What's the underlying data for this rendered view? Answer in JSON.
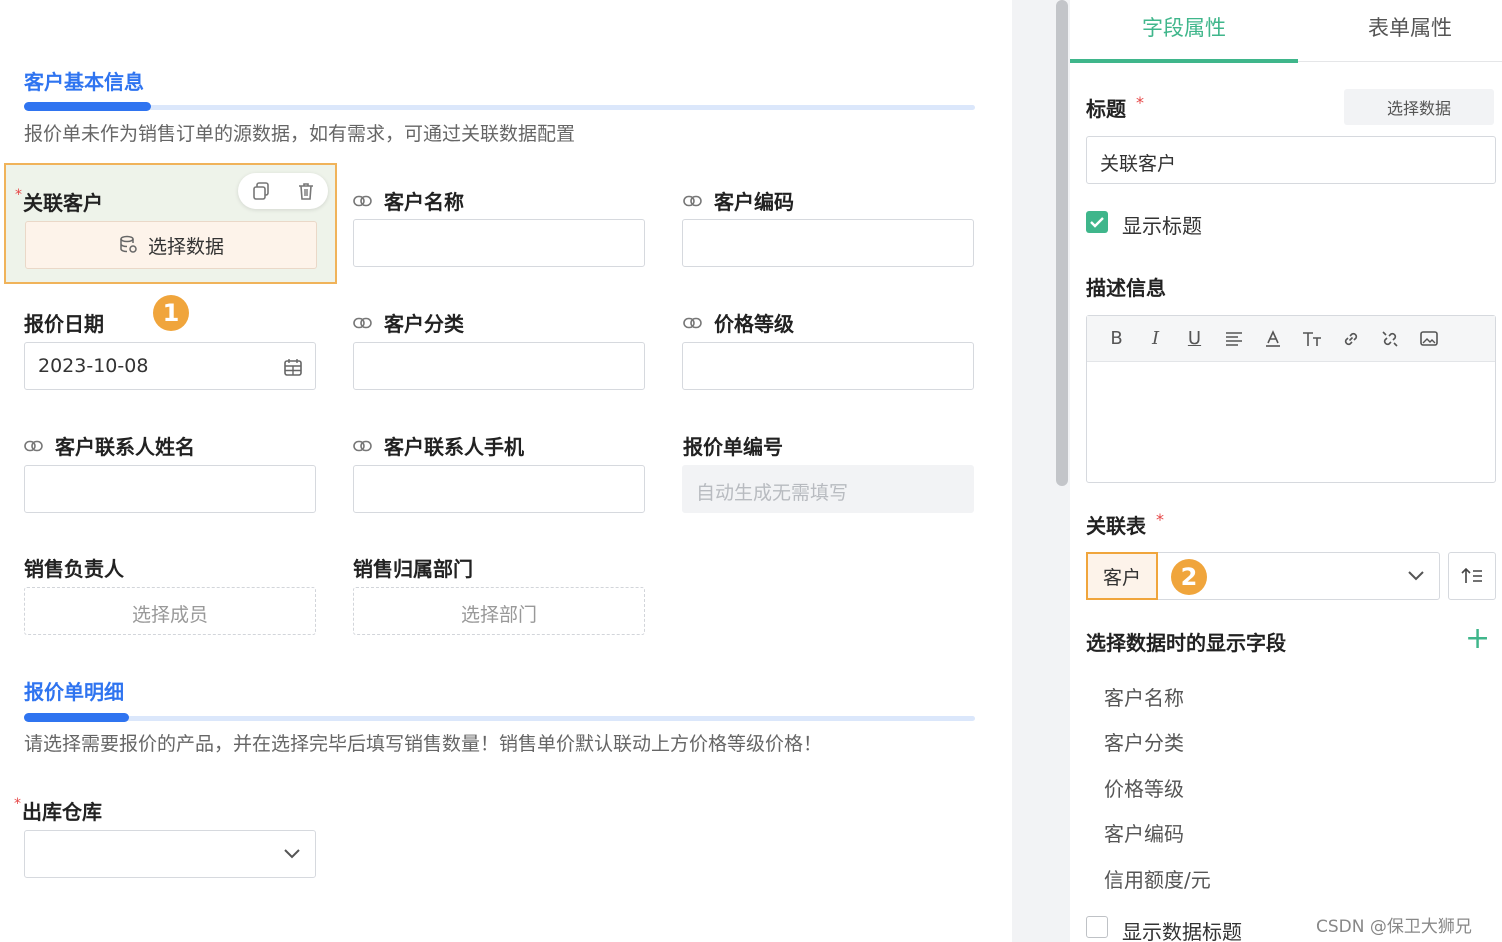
{
  "form": {
    "section1": {
      "title": "客户基本信息",
      "desc": "报价单未作为销售订单的源数据，如有需求，可通过关联数据配置"
    },
    "fields": {
      "related_customer": {
        "label": "关联客户",
        "button": "选择数据"
      },
      "customer_name": {
        "label": "客户名称"
      },
      "customer_code": {
        "label": "客户编码"
      },
      "quote_date": {
        "label": "报价日期",
        "value": "2023-10-08"
      },
      "customer_category": {
        "label": "客户分类"
      },
      "price_level": {
        "label": "价格等级"
      },
      "contact_name": {
        "label": "客户联系人姓名"
      },
      "contact_phone": {
        "label": "客户联系人手机"
      },
      "quote_number": {
        "label": "报价单编号",
        "placeholder": "自动生成无需填写"
      },
      "sales_owner": {
        "label": "销售负责人",
        "button": "选择成员"
      },
      "sales_department": {
        "label": "销售归属部门",
        "button": "选择部门"
      },
      "warehouse": {
        "label": "出库仓库"
      }
    },
    "section2": {
      "title": "报价单明细",
      "desc": "请选择需要报价的产品，并在选择完毕后填写销售数量！销售单价默认联动上方价格等级价格！"
    },
    "badge1": "1"
  },
  "panel": {
    "tabs": [
      "字段属性",
      "表单属性"
    ],
    "title_label": "标题",
    "select_data_btn": "选择数据",
    "title_value": "关联客户",
    "show_title_label": "显示标题",
    "description_label": "描述信息",
    "editor_toolbar": [
      "B",
      "I",
      "U",
      "align-icon",
      "font-color-icon",
      "font-size-icon",
      "link-icon",
      "unlink-icon",
      "image-icon"
    ],
    "related_table_label": "关联表",
    "related_table_value": "客户",
    "badge2": "2",
    "display_fields_label": "选择数据时的显示字段",
    "display_fields": [
      "客户名称",
      "客户分类",
      "价格等级",
      "客户编码",
      "信用额度/元"
    ],
    "show_data_title_label": "显示数据标题"
  },
  "watermark": "CSDN @保卫大狮兄",
  "colors": {
    "accent_blue": "#2f74f0",
    "accent_green": "#3fb68b",
    "highlight_orange": "#f0a53c"
  }
}
